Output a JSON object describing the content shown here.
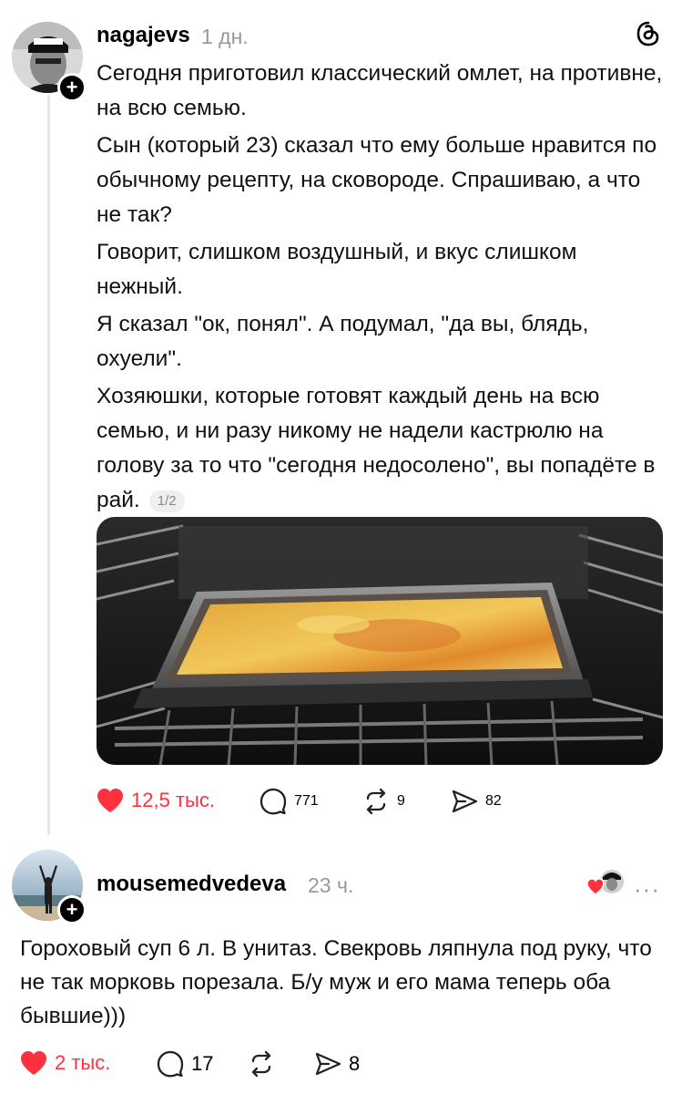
{
  "post": {
    "username": "nagajevs",
    "time": "1 дн.",
    "paragraphs": [
      "Сегодня приготовил классический омлет, на противне, на всю семью.",
      "Сын (который 23) сказал что ему больше нравится по обычному рецепту, на сковороде. Спрашиваю, а что не так?",
      "Говорит, слишком воздушный, и вкус слишком нежный.",
      "Я сказал \"ок, понял\". А подумал, \"да вы, блядь, охуели\".",
      "Хозяюшки, которые готовят каждый день на всю семью, и ни разу никому не надели кастрюлю на голову за то что \"сегодня недосолено\", вы попадёте в рай."
    ],
    "page_indicator": "1/2",
    "likes": "12,5 тыс.",
    "comments": "771",
    "reposts": "9",
    "shares": "82"
  },
  "reply": {
    "username": "mousemedvedeva",
    "time": "23 ч.",
    "text": "Гороховый суп 6 л. В унитаз. Свекровь ляпнула под руку,  что не так морковь порезала. Б/у муж и его мама теперь оба бывшие)))",
    "likes": "2 тыс.",
    "comments": "17",
    "shares": "8",
    "more": "···"
  },
  "colors": {
    "like_red": "#ff3040",
    "muted_gray": "#999999",
    "thread_line": "#e6e6e6"
  },
  "icons": [
    "threads-logo-icon",
    "heart-icon",
    "comment-icon",
    "repost-icon",
    "share-icon",
    "more-icon",
    "plus-icon"
  ]
}
